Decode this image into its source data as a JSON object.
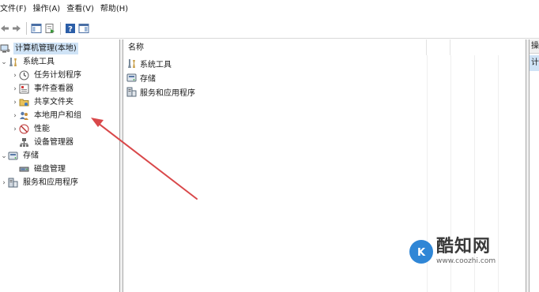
{
  "menu": [
    "文件(F)",
    "操作(A)",
    "查看(V)",
    "帮助(H)"
  ],
  "tree": {
    "root": "计算机管理(本地)",
    "system_tools": "系统工具",
    "task_scheduler": "任务计划程序",
    "event_viewer": "事件查看器",
    "shared_folders": "共享文件夹",
    "local_users_groups": "本地用户和组",
    "performance": "性能",
    "device_manager": "设备管理器",
    "storage": "存储",
    "disk_management": "磁盘管理",
    "services_apps": "服务和应用程序"
  },
  "list": {
    "column_name": "名称",
    "items": [
      "系统工具",
      "存储",
      "服务和应用程序"
    ]
  },
  "actions": {
    "header": "操",
    "item": "计"
  },
  "watermark": {
    "brand": "酷知网",
    "url": "www.coozhi.com"
  },
  "colors": {
    "selection": "#cfe3f6",
    "arrow": "#d9484a",
    "logo": "#2f86d6"
  }
}
